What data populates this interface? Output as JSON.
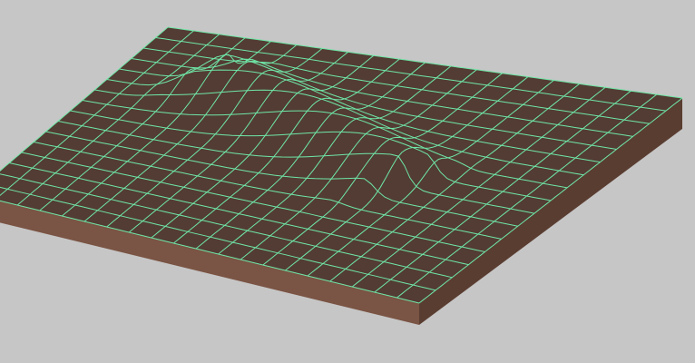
{
  "scene": {
    "background_color": "#c6c6c6",
    "top_surface_color": "#533c34",
    "deformed_ridge_color": "#533c34",
    "front_side_color": "#7a5444",
    "right_side_color": "#5a3d31",
    "wireframe_color": "#6fe6a6",
    "grid_divisions_u": 20,
    "grid_divisions_v": 16
  }
}
